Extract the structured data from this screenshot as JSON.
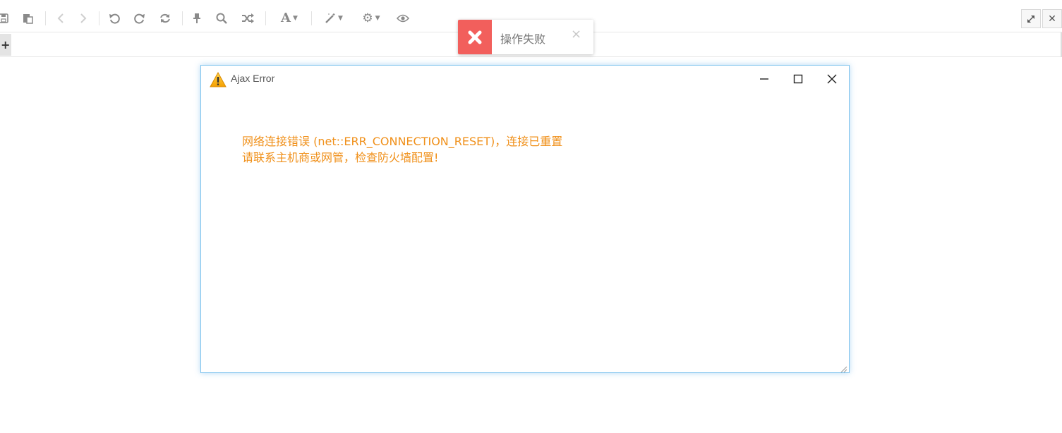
{
  "toolbar": {
    "icons": [
      "save-icon",
      "paste-icon",
      "back-icon",
      "forward-icon",
      "undo-icon",
      "redo-icon",
      "refresh-icon",
      "pin-icon",
      "search-icon",
      "shuffle-icon",
      "font-icon",
      "magic-wand-icon",
      "gear-icon",
      "eye-icon"
    ],
    "window_buttons": [
      "expand-icon",
      "close-icon"
    ]
  },
  "tabbar": {
    "add_label": "+"
  },
  "toast": {
    "message": "操作失败",
    "close_label": "×",
    "accent": "#f25f5c"
  },
  "dialog": {
    "title": "Ajax Error",
    "message_line1": "网络连接错误 (net::ERR_CONNECTION_RESET)，连接已重置",
    "message_line2": "请联系主机商或网管，检查防火墙配置!",
    "message_color": "#f0901a",
    "border_color": "#7ec3ee"
  }
}
